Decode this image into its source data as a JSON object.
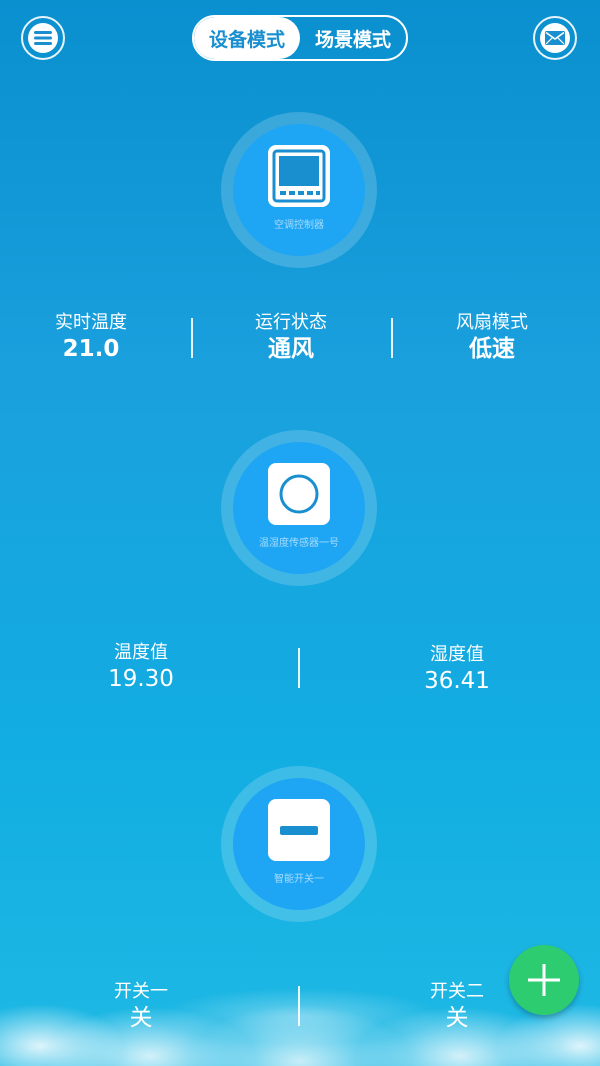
{
  "header": {
    "menu_icon": "menu-icon",
    "mail_icon": "mail-icon",
    "tabs": [
      {
        "label": "设备模式",
        "active": true
      },
      {
        "label": "场景模式",
        "active": false
      }
    ]
  },
  "devices": [
    {
      "icon": "thermostat-panel-icon",
      "label": "空调控制器",
      "stats": [
        {
          "key": "实时温度",
          "value": "21.0"
        },
        {
          "key": "运行状态",
          "value": "通风"
        },
        {
          "key": "风扇模式",
          "value": "低速"
        }
      ]
    },
    {
      "icon": "sensor-circle-icon",
      "label": "温湿度传感器一号",
      "stats": [
        {
          "key": "温度值",
          "value": "19.30"
        },
        {
          "key": "湿度值",
          "value": "36.41"
        }
      ]
    },
    {
      "icon": "switch-icon",
      "label": "智能开关一",
      "stats": [
        {
          "key": "开关一",
          "value": "关"
        },
        {
          "key": "开关二",
          "value": "关"
        }
      ]
    }
  ],
  "fab": {
    "icon": "plus-icon"
  },
  "colors": {
    "accent": "#1ea6f5",
    "fab": "#2ecc71",
    "active_tab_text": "#1a8fd0"
  }
}
